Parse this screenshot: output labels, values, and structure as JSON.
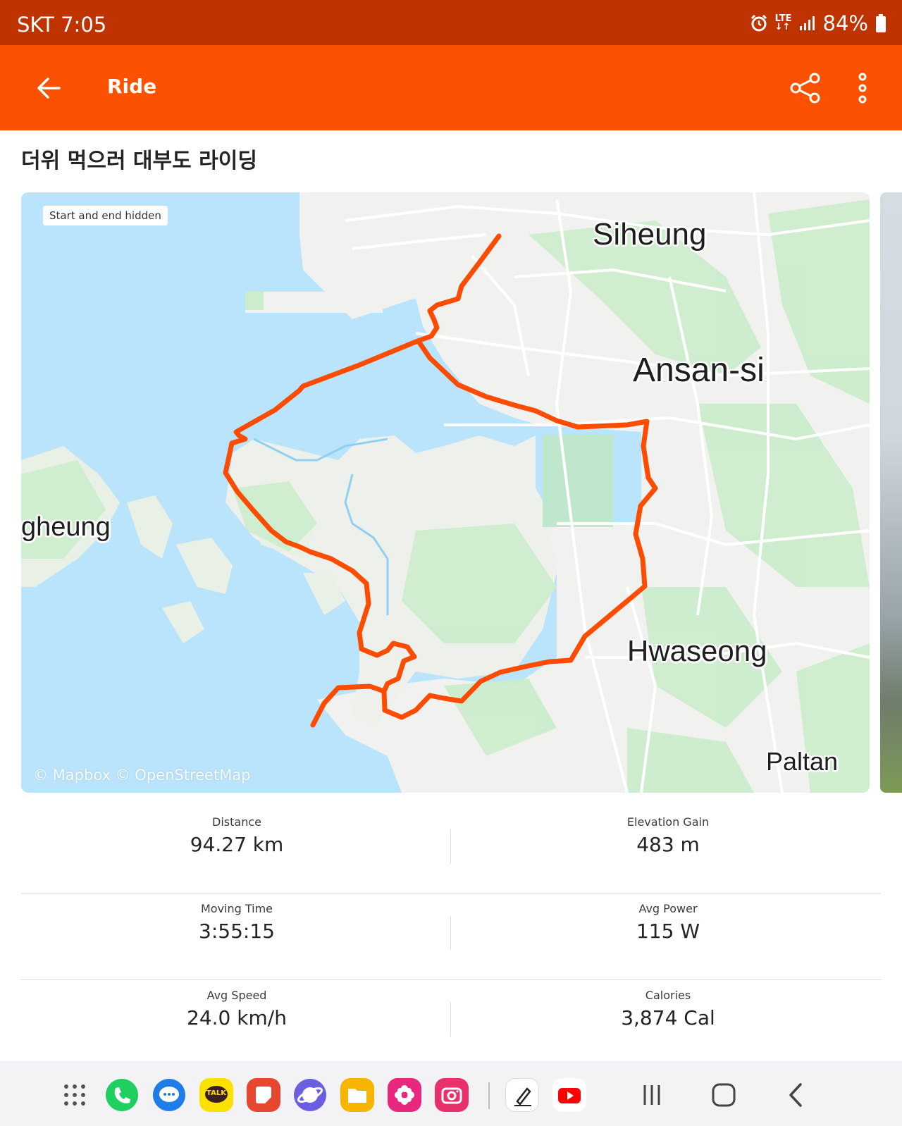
{
  "status_bar": {
    "carrier_time": "SKT 7:05",
    "network": "LTE",
    "battery": "84%",
    "icons": [
      "alarm-icon",
      "lte-icon",
      "signal-icon",
      "battery-icon"
    ]
  },
  "app_bar": {
    "title": "Ride",
    "icons": [
      "back-arrow-icon",
      "share-icon",
      "more-vertical-icon"
    ]
  },
  "activity": {
    "title": "더위 먹으러 대부도 라이딩"
  },
  "map": {
    "privacy_label": "Start and end hidden",
    "credit": "© Mapbox © OpenStreetMap",
    "place_labels": [
      "Siheung",
      "Ansan-si",
      "gheung",
      "Hwaseong",
      "Paltan"
    ],
    "route_color": "#fc4c02"
  },
  "stats": [
    {
      "left": {
        "label": "Distance",
        "value": "94.27 km"
      },
      "right": {
        "label": "Elevation Gain",
        "value": "483 m"
      }
    },
    {
      "left": {
        "label": "Moving Time",
        "value": "3:55:15"
      },
      "right": {
        "label": "Avg Power",
        "value": "115 W"
      }
    },
    {
      "left": {
        "label": "Avg Speed",
        "value": "24.0 km/h"
      },
      "right": {
        "label": "Calories",
        "value": "3,874 Cal"
      }
    }
  ],
  "nav_bar": {
    "dock_apps": [
      "app-drawer-icon",
      "phone-icon",
      "messages-icon",
      "kakaotalk-icon",
      "notes-icon",
      "internet-icon",
      "my-files-icon",
      "gallery-icon",
      "camera-icon",
      "pen-up-icon",
      "youtube-icon"
    ],
    "kakaotalk_label": "TALK",
    "system_buttons": [
      "recents-icon",
      "home-icon",
      "back-nav-icon"
    ]
  },
  "colors": {
    "status_bar": "#bf3300",
    "app_bar": "#fc5200",
    "water": "#b9e4fb",
    "land": "#f1f2ef",
    "green": "#cdeccd"
  }
}
